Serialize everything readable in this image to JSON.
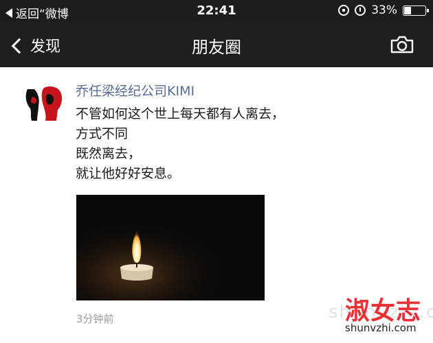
{
  "status_bar": {
    "back_app_label": "返回“微博",
    "time": "22:41",
    "battery_text": "33%",
    "battery_level": 0.33,
    "icons": [
      "back-arrow-icon",
      "rotation-lock-icon",
      "alarm-icon",
      "battery-icon"
    ]
  },
  "nav": {
    "back_label": "发现",
    "title": "朋友圈",
    "right_icon": "camera-icon"
  },
  "post": {
    "author": "乔任梁经纪公司KIMI",
    "lines": [
      "不管如何这个世上每天都有人离去，",
      "方式不同",
      "既然离去，",
      "就让他好好安息。"
    ],
    "image": "candle-photo",
    "time_ago": "3分钟前"
  },
  "watermark": {
    "brand": "淑女志",
    "url": "shunvzhi.com"
  },
  "colors": {
    "bar_bg": "#1f1f21",
    "author_link": "#576b95",
    "watermark_red": "#ec2f34"
  }
}
